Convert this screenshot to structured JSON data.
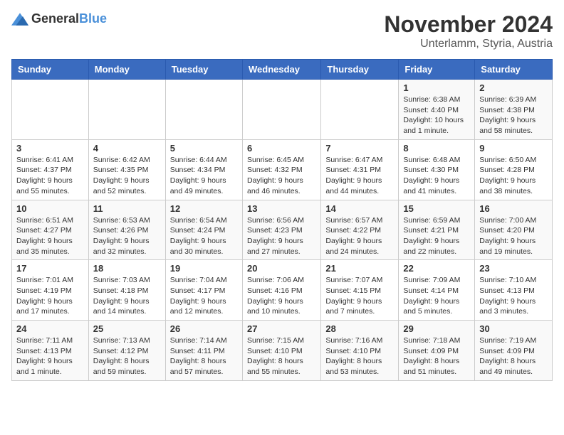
{
  "logo": {
    "text_general": "General",
    "text_blue": "Blue"
  },
  "title": "November 2024",
  "subtitle": "Unterlamm, Styria, Austria",
  "calendar": {
    "headers": [
      "Sunday",
      "Monday",
      "Tuesday",
      "Wednesday",
      "Thursday",
      "Friday",
      "Saturday"
    ],
    "weeks": [
      [
        {
          "day": "",
          "detail": ""
        },
        {
          "day": "",
          "detail": ""
        },
        {
          "day": "",
          "detail": ""
        },
        {
          "day": "",
          "detail": ""
        },
        {
          "day": "",
          "detail": ""
        },
        {
          "day": "1",
          "detail": "Sunrise: 6:38 AM\nSunset: 4:40 PM\nDaylight: 10 hours and 1 minute."
        },
        {
          "day": "2",
          "detail": "Sunrise: 6:39 AM\nSunset: 4:38 PM\nDaylight: 9 hours and 58 minutes."
        }
      ],
      [
        {
          "day": "3",
          "detail": "Sunrise: 6:41 AM\nSunset: 4:37 PM\nDaylight: 9 hours and 55 minutes."
        },
        {
          "day": "4",
          "detail": "Sunrise: 6:42 AM\nSunset: 4:35 PM\nDaylight: 9 hours and 52 minutes."
        },
        {
          "day": "5",
          "detail": "Sunrise: 6:44 AM\nSunset: 4:34 PM\nDaylight: 9 hours and 49 minutes."
        },
        {
          "day": "6",
          "detail": "Sunrise: 6:45 AM\nSunset: 4:32 PM\nDaylight: 9 hours and 46 minutes."
        },
        {
          "day": "7",
          "detail": "Sunrise: 6:47 AM\nSunset: 4:31 PM\nDaylight: 9 hours and 44 minutes."
        },
        {
          "day": "8",
          "detail": "Sunrise: 6:48 AM\nSunset: 4:30 PM\nDaylight: 9 hours and 41 minutes."
        },
        {
          "day": "9",
          "detail": "Sunrise: 6:50 AM\nSunset: 4:28 PM\nDaylight: 9 hours and 38 minutes."
        }
      ],
      [
        {
          "day": "10",
          "detail": "Sunrise: 6:51 AM\nSunset: 4:27 PM\nDaylight: 9 hours and 35 minutes."
        },
        {
          "day": "11",
          "detail": "Sunrise: 6:53 AM\nSunset: 4:26 PM\nDaylight: 9 hours and 32 minutes."
        },
        {
          "day": "12",
          "detail": "Sunrise: 6:54 AM\nSunset: 4:24 PM\nDaylight: 9 hours and 30 minutes."
        },
        {
          "day": "13",
          "detail": "Sunrise: 6:56 AM\nSunset: 4:23 PM\nDaylight: 9 hours and 27 minutes."
        },
        {
          "day": "14",
          "detail": "Sunrise: 6:57 AM\nSunset: 4:22 PM\nDaylight: 9 hours and 24 minutes."
        },
        {
          "day": "15",
          "detail": "Sunrise: 6:59 AM\nSunset: 4:21 PM\nDaylight: 9 hours and 22 minutes."
        },
        {
          "day": "16",
          "detail": "Sunrise: 7:00 AM\nSunset: 4:20 PM\nDaylight: 9 hours and 19 minutes."
        }
      ],
      [
        {
          "day": "17",
          "detail": "Sunrise: 7:01 AM\nSunset: 4:19 PM\nDaylight: 9 hours and 17 minutes."
        },
        {
          "day": "18",
          "detail": "Sunrise: 7:03 AM\nSunset: 4:18 PM\nDaylight: 9 hours and 14 minutes."
        },
        {
          "day": "19",
          "detail": "Sunrise: 7:04 AM\nSunset: 4:17 PM\nDaylight: 9 hours and 12 minutes."
        },
        {
          "day": "20",
          "detail": "Sunrise: 7:06 AM\nSunset: 4:16 PM\nDaylight: 9 hours and 10 minutes."
        },
        {
          "day": "21",
          "detail": "Sunrise: 7:07 AM\nSunset: 4:15 PM\nDaylight: 9 hours and 7 minutes."
        },
        {
          "day": "22",
          "detail": "Sunrise: 7:09 AM\nSunset: 4:14 PM\nDaylight: 9 hours and 5 minutes."
        },
        {
          "day": "23",
          "detail": "Sunrise: 7:10 AM\nSunset: 4:13 PM\nDaylight: 9 hours and 3 minutes."
        }
      ],
      [
        {
          "day": "24",
          "detail": "Sunrise: 7:11 AM\nSunset: 4:13 PM\nDaylight: 9 hours and 1 minute."
        },
        {
          "day": "25",
          "detail": "Sunrise: 7:13 AM\nSunset: 4:12 PM\nDaylight: 8 hours and 59 minutes."
        },
        {
          "day": "26",
          "detail": "Sunrise: 7:14 AM\nSunset: 4:11 PM\nDaylight: 8 hours and 57 minutes."
        },
        {
          "day": "27",
          "detail": "Sunrise: 7:15 AM\nSunset: 4:10 PM\nDaylight: 8 hours and 55 minutes."
        },
        {
          "day": "28",
          "detail": "Sunrise: 7:16 AM\nSunset: 4:10 PM\nDaylight: 8 hours and 53 minutes."
        },
        {
          "day": "29",
          "detail": "Sunrise: 7:18 AM\nSunset: 4:09 PM\nDaylight: 8 hours and 51 minutes."
        },
        {
          "day": "30",
          "detail": "Sunrise: 7:19 AM\nSunset: 4:09 PM\nDaylight: 8 hours and 49 minutes."
        }
      ]
    ]
  }
}
